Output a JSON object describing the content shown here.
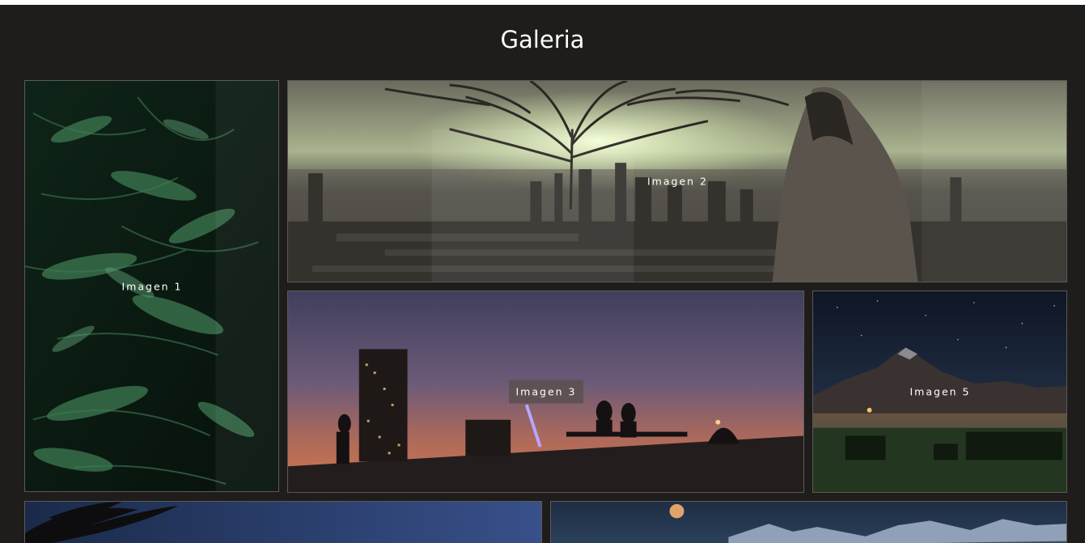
{
  "gallery": {
    "title": "Galeria",
    "images": [
      {
        "caption": "Imagen 1",
        "subject": "fern-foliage"
      },
      {
        "caption": "Imagen 2",
        "subject": "tree-over-city-with-cloaked-statue"
      },
      {
        "caption": "Imagen 3",
        "subject": "city-skyline-silhouettes-at-dusk"
      },
      {
        "caption": "Imagen 5",
        "subject": "mountain-night-sky"
      },
      {
        "caption": "",
        "subject": "palm-trees-blue-sky"
      },
      {
        "caption": "",
        "subject": "moon-over-mountains"
      }
    ]
  },
  "colors": {
    "page_background": "#1e1d1b",
    "title_text": "#ffffff",
    "tile_border": "#5c5a57",
    "caption_box": "#5a5050"
  }
}
